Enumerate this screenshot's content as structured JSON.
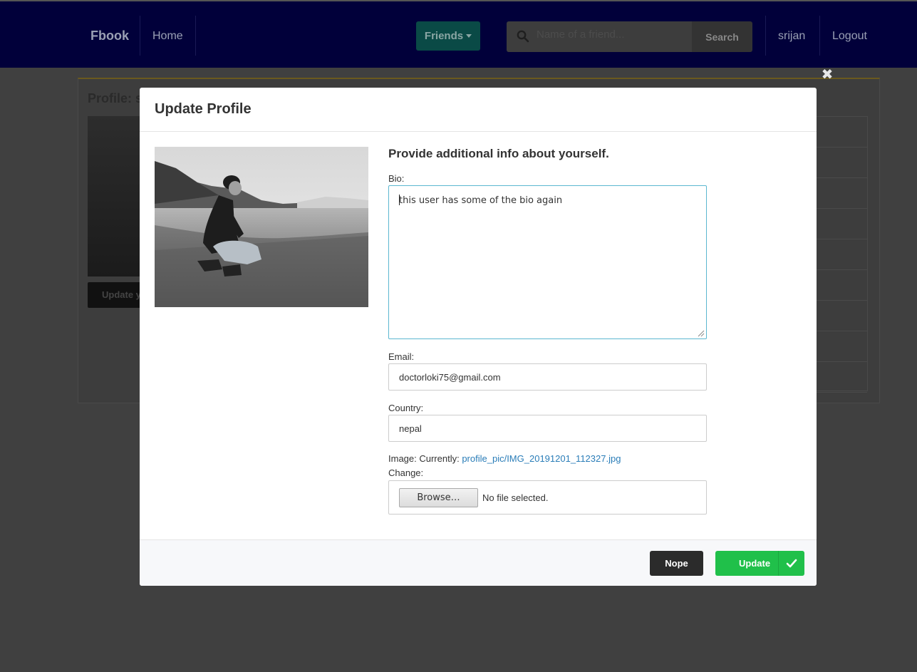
{
  "navbar": {
    "brand": "Fbook",
    "home": "Home",
    "friends": "Friends",
    "search_placeholder": "Name of a friend...",
    "search_button": "Search",
    "user": "srijan",
    "logout": "Logout"
  },
  "background_page": {
    "title": "Profile: sr",
    "update_button": "Update y"
  },
  "modal": {
    "title": "Update Profile",
    "heading": "Provide additional info about yourself.",
    "bio_label": "Bio:",
    "bio_value": "this user has some of the bio again",
    "email_label": "Email:",
    "email_value": "doctorloki75@gmail.com",
    "country_label": "Country:",
    "country_value": "nepal",
    "image_label": "Image: Currently:",
    "image_current": "profile_pic/IMG_20191201_112327.jpg",
    "change_label": "Change:",
    "browse_button": "Browse…",
    "no_file": "No file selected.",
    "nope_button": "Nope",
    "update_button": "Update"
  },
  "colors": {
    "navbar_bg": "#01003a",
    "friends_btn": "#0a4a46",
    "update_green": "#20c04a",
    "link_blue": "#2a7db8",
    "overlay": "#404040"
  }
}
